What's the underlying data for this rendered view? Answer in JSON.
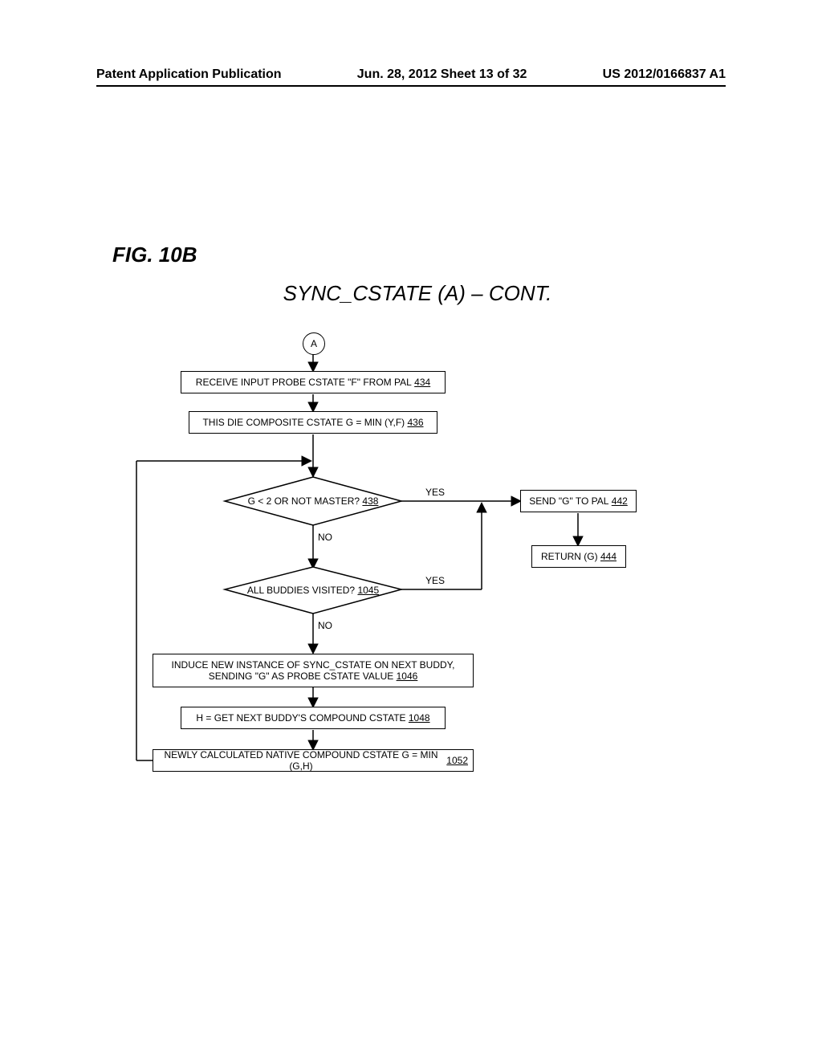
{
  "header": {
    "left": "Patent Application Publication",
    "mid": "Jun. 28, 2012  Sheet 13 of 32",
    "right": "US 2012/0166837 A1"
  },
  "figure_label": "FIG. 10B",
  "subtitle": "SYNC_CSTATE (A) – CONT.",
  "connector_a": "A",
  "steps": {
    "s434": {
      "text": "RECEIVE INPUT PROBE CSTATE \"F\" FROM PAL",
      "ref": "434"
    },
    "s436": {
      "text": "THIS DIE COMPOSITE CSTATE G = MIN (Y,F)",
      "ref": "436"
    },
    "s438": {
      "text": "G < 2 OR NOT MASTER?",
      "ref": "438"
    },
    "s442": {
      "text": "SEND \"G\" TO PAL",
      "ref": "442"
    },
    "s444": {
      "text": "RETURN (G)",
      "ref": "444"
    },
    "s1045": {
      "text": "ALL BUDDIES VISITED?",
      "ref": "1045"
    },
    "s1046": {
      "text": "INDUCE NEW INSTANCE OF SYNC_CSTATE ON NEXT BUDDY, SENDING \"G\" AS PROBE CSTATE VALUE",
      "ref": "1046"
    },
    "s1048": {
      "text": "H = GET NEXT BUDDY'S COMPOUND CSTATE",
      "ref": "1048"
    },
    "s1052": {
      "text": "NEWLY CALCULATED NATIVE COMPOUND CSTATE G = MIN (G,H)",
      "ref": "1052"
    }
  },
  "labels": {
    "yes": "YES",
    "no": "NO"
  }
}
